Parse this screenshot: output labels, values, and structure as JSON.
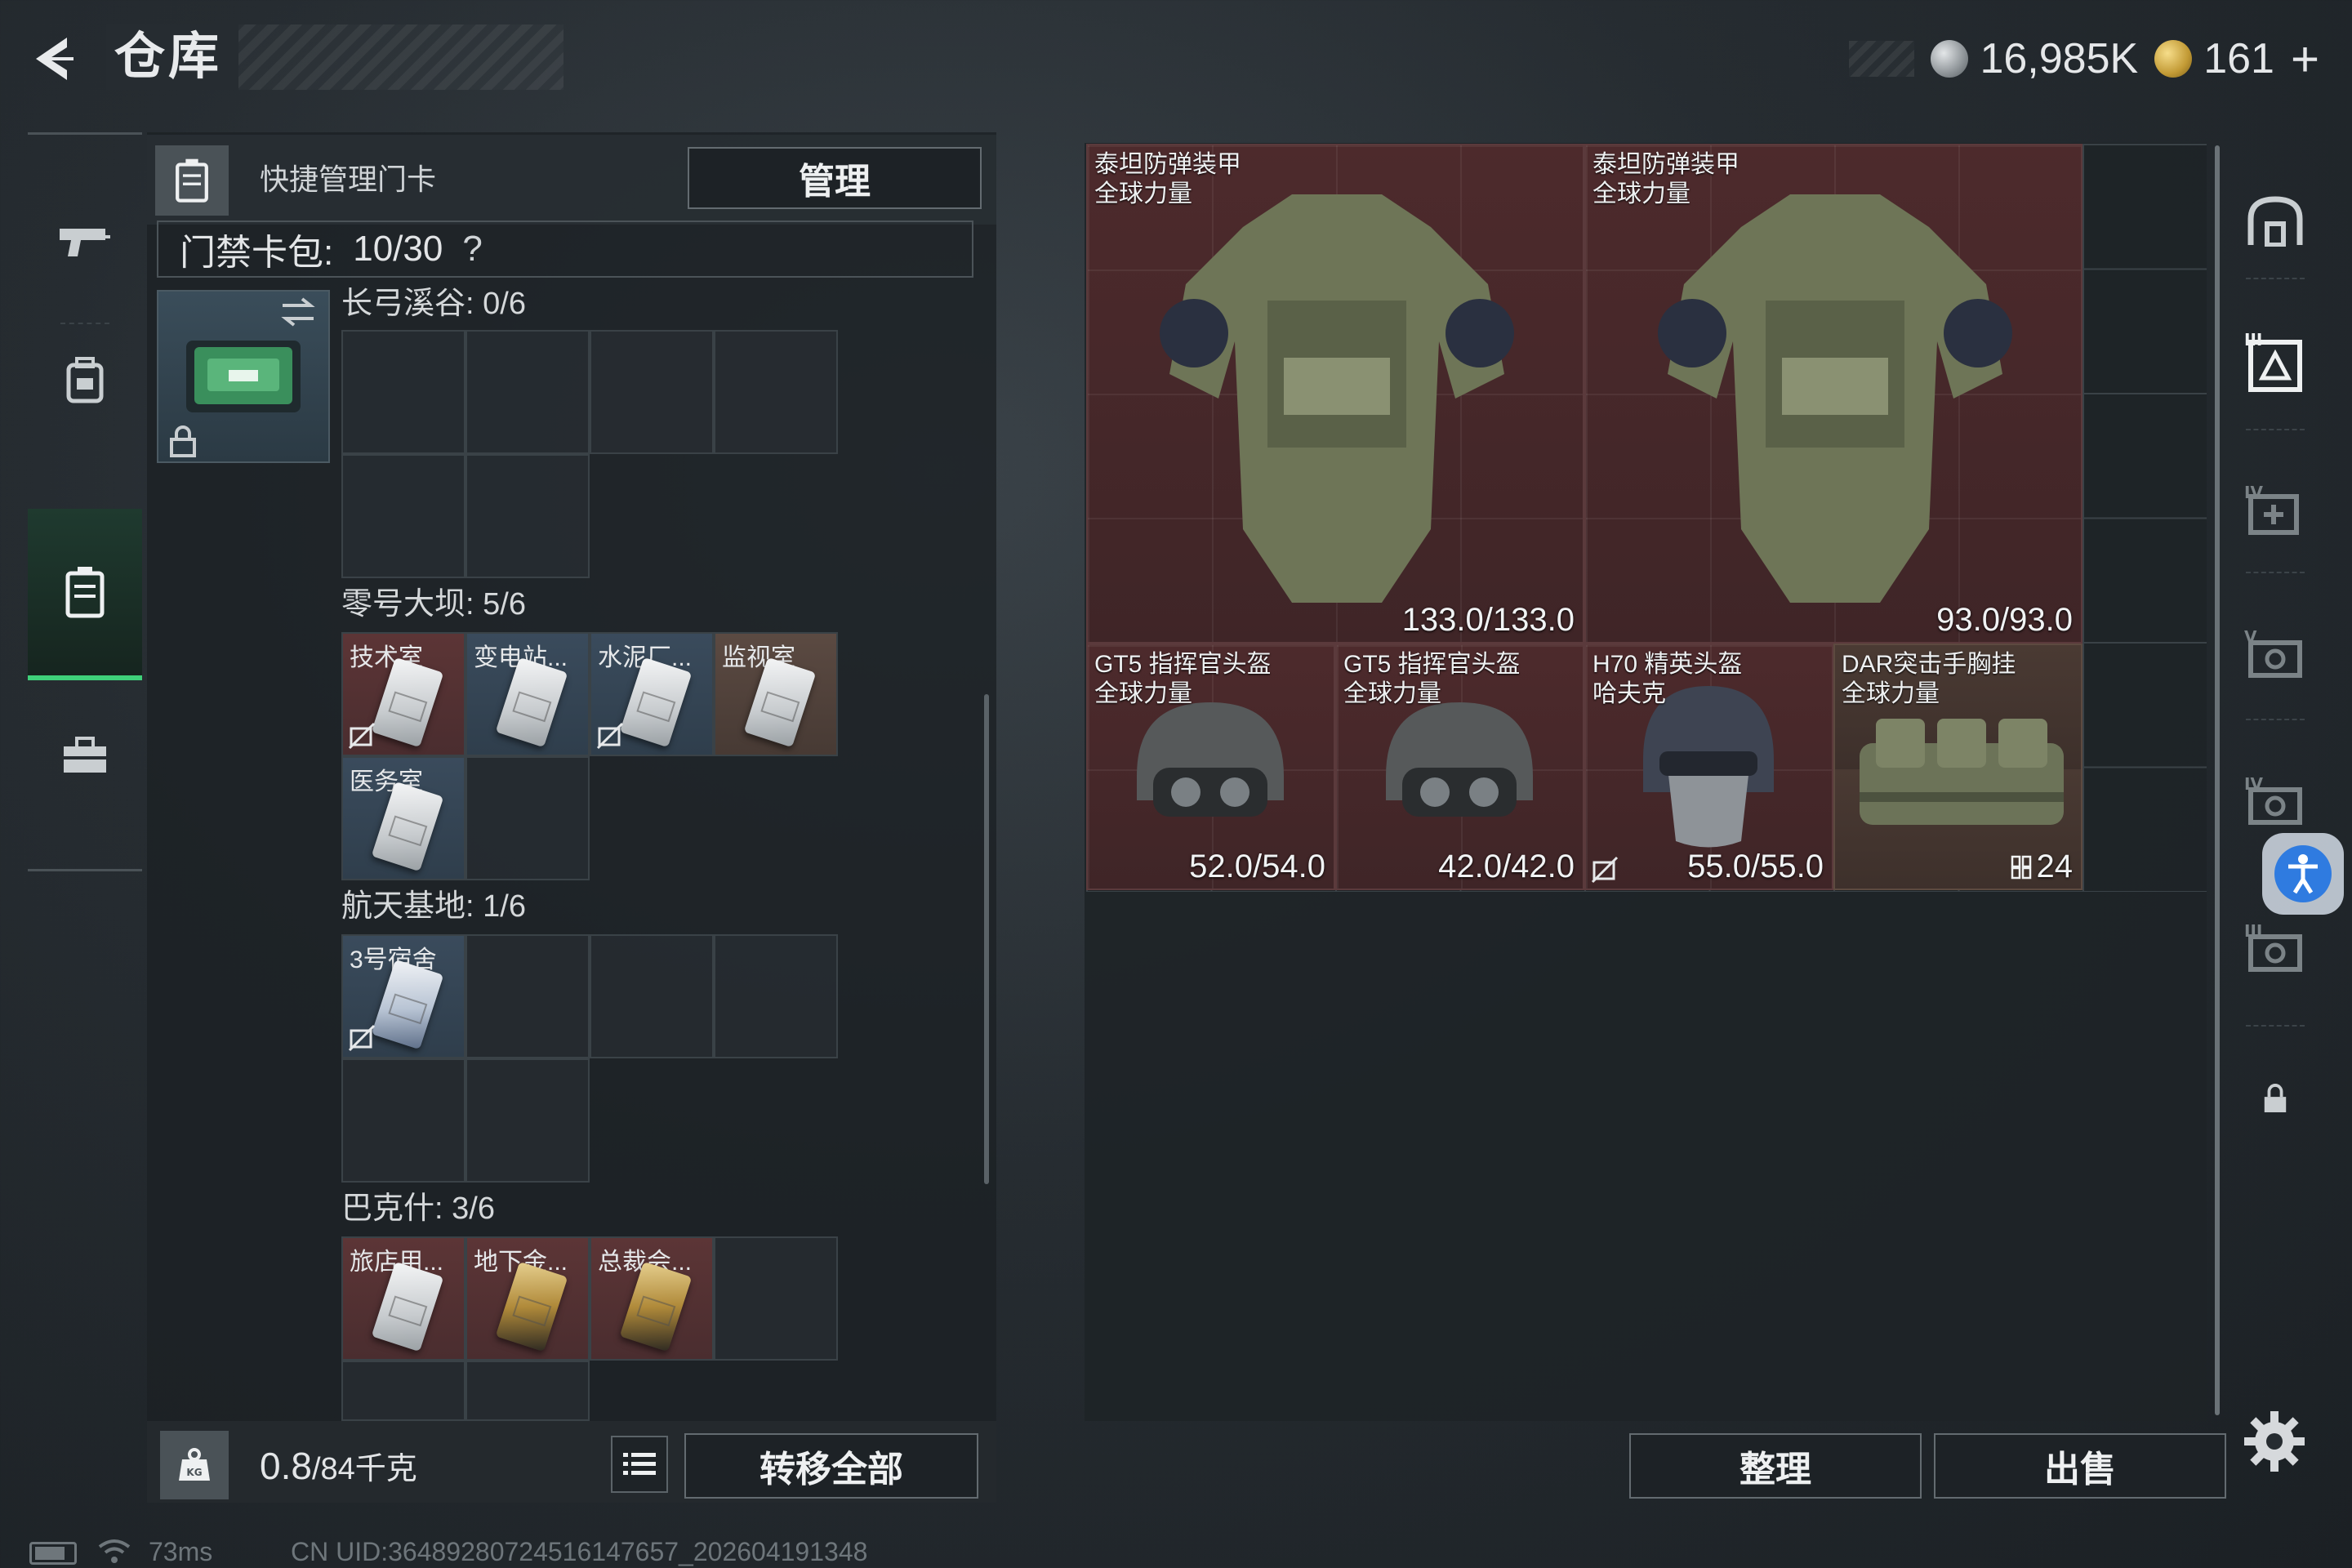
{
  "header": {
    "title": "仓库",
    "currencies": [
      {
        "icon": "silver-coin-icon",
        "value": "16,985K"
      },
      {
        "icon": "gold-coin-icon",
        "value": "161"
      }
    ],
    "add_label": "+"
  },
  "left_nav": [
    {
      "icon": "gun-icon",
      "active": false
    },
    {
      "icon": "backpack-icon",
      "active": false
    },
    {
      "icon": "keycard-case-icon",
      "active": true
    },
    {
      "icon": "toolbox-icon",
      "active": false
    }
  ],
  "key_panel": {
    "header_label": "快捷管理门卡",
    "manage_label": "管理",
    "cardpack_label": "门禁卡包:",
    "cardpack_value": "10/30",
    "help_label": "?",
    "maps": [
      {
        "name": "长弓溪谷",
        "count": "0/6",
        "cards": []
      },
      {
        "name": "零号大坝",
        "count": "5/6",
        "cards": [
          {
            "label": "技术室",
            "tint": "red",
            "nosell": true
          },
          {
            "label": "变电站...",
            "tint": "blue",
            "nosell": false
          },
          {
            "label": "水泥厂...",
            "tint": "blue",
            "nosell": true
          },
          {
            "label": "监视室",
            "tint": "brown",
            "nosell": false
          },
          {
            "label": "医务室",
            "tint": "blue",
            "nosell": false
          }
        ]
      },
      {
        "name": "航天基地",
        "count": "1/6",
        "cards": [
          {
            "label": "3号宿舍",
            "tint": "blue",
            "nosell": true
          }
        ]
      },
      {
        "name": "巴克什",
        "count": "3/6",
        "cards": [
          {
            "label": "旅店用...",
            "tint": "red",
            "nosell": false
          },
          {
            "label": "地下金...",
            "tint": "red",
            "nosell": false
          },
          {
            "label": "总裁会...",
            "tint": "red",
            "nosell": false
          }
        ]
      }
    ]
  },
  "weight": {
    "current": "0.8",
    "max": "/84千克"
  },
  "left_actions": {
    "transfer_all_label": "转移全部"
  },
  "stash": {
    "items": [
      {
        "name": "泰坦防弹装甲",
        "sub": "全球力量",
        "durability": "133.0/133.0",
        "icon": "body-armor-icon"
      },
      {
        "name": "泰坦防弹装甲",
        "sub": "全球力量",
        "durability": "93.0/93.0",
        "icon": "body-armor-icon"
      },
      {
        "name": "GT5 指挥官头盔",
        "sub": "全球力量",
        "durability": "52.0/54.0",
        "icon": "helmet-icon"
      },
      {
        "name": "GT5 指挥官头盔",
        "sub": "全球力量",
        "durability": "42.0/42.0",
        "icon": "helmet-icon"
      },
      {
        "name": "H70 精英头盔",
        "sub": "哈夫克",
        "durability": "55.0/55.0",
        "icon": "helmet-icon"
      },
      {
        "name": "DAR突击手胸挂",
        "sub": "全球力量",
        "durability": "24",
        "icon": "chest-rig-icon"
      }
    ],
    "sort_label": "整理",
    "sell_label": "出售"
  },
  "right_nav": [
    {
      "icon": "stash-home-icon"
    },
    {
      "icon": "armor-tier-3-icon"
    },
    {
      "icon": "armor-tier-4-icon"
    },
    {
      "icon": "armor-tier-5-icon"
    },
    {
      "icon": "armor-tier-4b-icon"
    },
    {
      "icon": "armor-tier-3b-icon"
    },
    {
      "icon": "lock-icon"
    }
  ],
  "status_bar": {
    "ping": "73ms",
    "uid": "CN UID:3648928072451614765​7_202604191348"
  },
  "colors": {
    "accent_green": "#3fd17a",
    "item_red": "#4d2a2c",
    "accessibility_blue": "#2f7be0"
  }
}
